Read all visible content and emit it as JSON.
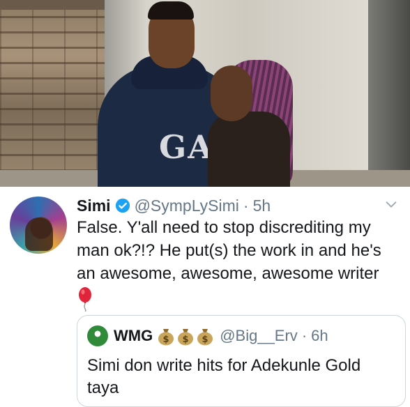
{
  "tweet": {
    "display_name": "Simi",
    "handle": "@SympLySimi",
    "separator": "·",
    "time": "5h",
    "text": "False. Y'all need to stop discrediting my man ok?!? He put(s) the work in and he's an awesome, awesome, awesome writer",
    "icons": {
      "verified": "verified-badge-icon",
      "menu": "chevron-down-icon",
      "emoji": "balloon-emoji-icon"
    }
  },
  "quoted_tweet": {
    "display_name": "WMG",
    "emojis": [
      "money-bag-icon",
      "money-bag-icon",
      "money-bag-icon"
    ],
    "handle": "@Big__Erv",
    "separator": "·",
    "time": "6h",
    "text": "Simi don write hits for Adekunle Gold taya"
  },
  "photo": {
    "shirt_text": "GAP"
  },
  "colors": {
    "verified_blue": "#1da1f2",
    "text": "#14171a",
    "muted": "#657786",
    "border": "#ccd6dd"
  }
}
